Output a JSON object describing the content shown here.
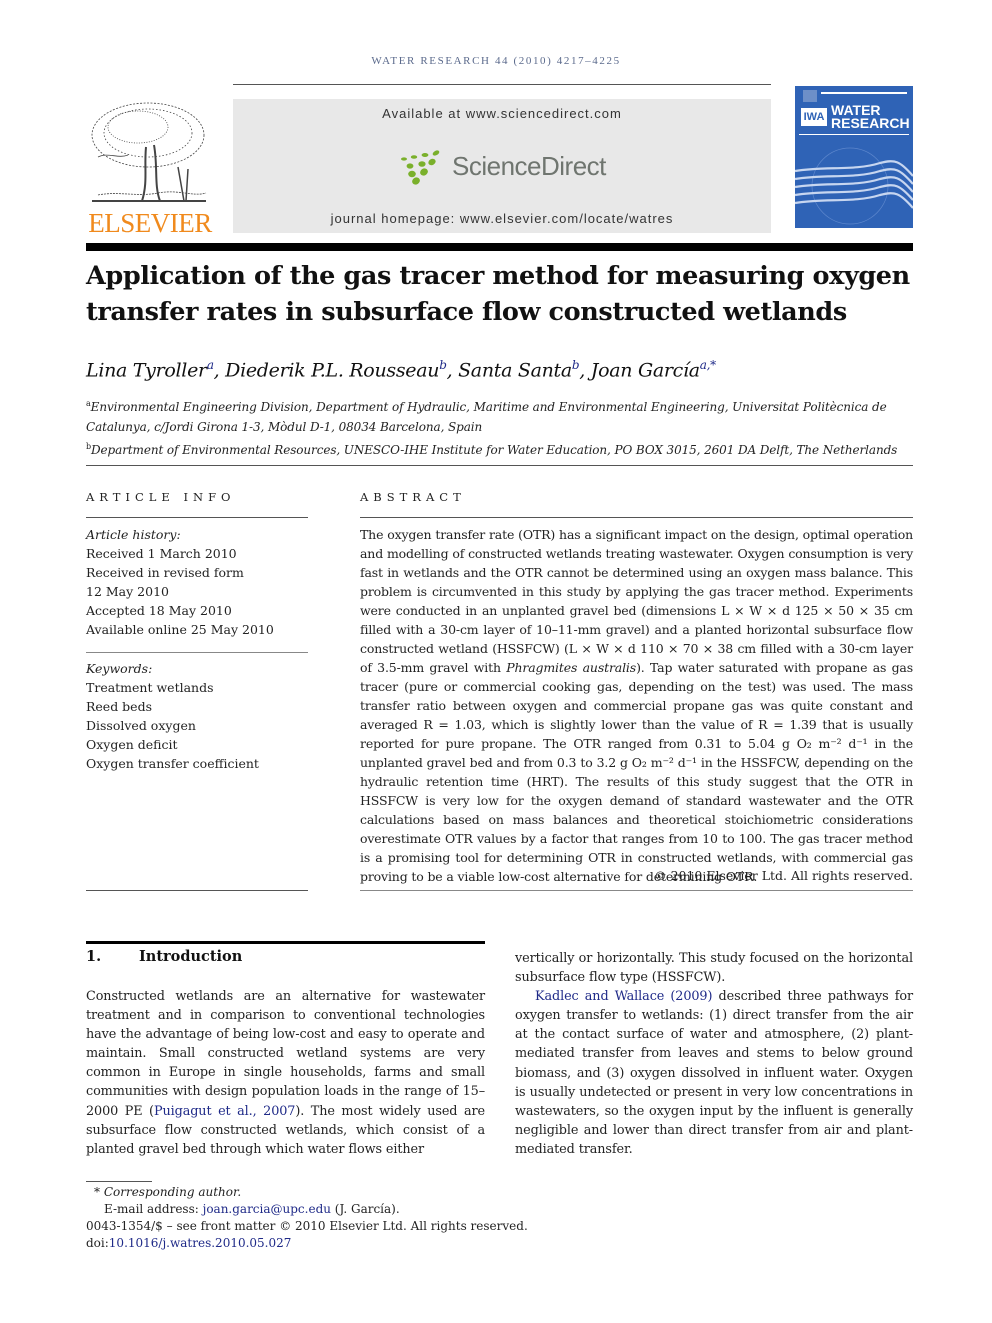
{
  "journal": {
    "running_head": "WATER RESEARCH 44 (2010) 4217–4225",
    "publisher_logo_text": "ELSEVIER",
    "sciencedirect": {
      "available_text": "Available at www.sciencedirect.com",
      "logo_text": "ScienceDirect",
      "homepage_text": "journal homepage: www.elsevier.com/locate/watres"
    },
    "cover": {
      "badge": "IWA",
      "title_line1": "WATER",
      "title_line2": "RESEARCH"
    },
    "colors": {
      "elsevier_orange": "#f08a1d",
      "sciencedirect_green": "#7ab02b",
      "cover_blue": "#2f63b6",
      "link_blue": "#1f2a88"
    }
  },
  "article": {
    "title": "Application of the gas tracer method for measuring oxygen transfer rates in subsurface flow constructed wetlands",
    "authors": [
      {
        "name": "Lina Tyroller",
        "sup": "a"
      },
      {
        "name": "Diederik P.L. Rousseau",
        "sup": "b"
      },
      {
        "name": "Santa Santa",
        "sup": "b"
      },
      {
        "name": "Joan García",
        "sup": "a,*"
      }
    ],
    "affiliations": [
      {
        "sup": "a",
        "text": "Environmental Engineering Division, Department of Hydraulic, Maritime and Environmental Engineering, Universitat Politècnica de Catalunya, c/Jordi Girona 1-3, Mòdul D-1, 08034 Barcelona, Spain"
      },
      {
        "sup": "b",
        "text": "Department of Environmental Resources, UNESCO-IHE Institute for Water Education, PO BOX 3015, 2601 DA Delft, The Netherlands"
      }
    ]
  },
  "article_info": {
    "heading": "ARTICLE INFO",
    "history_label": "Article history:",
    "history": [
      "Received 1 March 2010",
      "Received in revised form",
      "12 May 2010",
      "Accepted 18 May 2010",
      "Available online 25 May 2010"
    ],
    "keywords_label": "Keywords:",
    "keywords": [
      "Treatment wetlands",
      "Reed beds",
      "Dissolved oxygen",
      "Oxygen deficit",
      "Oxygen transfer coefficient"
    ]
  },
  "abstract": {
    "heading": "ABSTRACT",
    "part1": "The oxygen transfer rate (OTR) has a significant impact on the design, optimal operation and modelling of constructed wetlands treating wastewater. Oxygen consumption is very fast in wetlands and the OTR cannot be determined using an oxygen mass balance. This problem is circumvented in this study by applying the gas tracer method. Experiments were conducted in an unplanted gravel bed (dimensions L × W × d 125 × 50 × 35 cm filled with a 30-cm layer of 10–11-mm gravel) and a planted horizontal subsurface flow constructed wetland (HSSFCW) (L × W × d 110 × 70 × 38 cm filled with a 30-cm layer of 3.5-mm gravel with ",
    "species": "Phragmites australis",
    "part2": "). Tap water saturated with propane as gas tracer (pure or commercial cooking gas, depending on the test) was used. The mass transfer ratio between oxygen and commercial propane gas was quite constant and averaged R = 1.03, which is slightly lower than the value of R = 1.39 that is usually reported for pure propane. The OTR ranged from 0.31 to 5.04 g O₂ m⁻² d⁻¹ in the unplanted gravel bed and from 0.3 to 3.2 g O₂ m⁻² d⁻¹ in the HSSFCW, depending on the hydraulic retention time (HRT). The results of this study suggest that the OTR in HSSFCW is very low for the oxygen demand of standard wastewater and the OTR calculations based on mass balances and theoretical stoichiometric considerations overestimate OTR values by a factor that ranges from 10 to 100. The gas tracer method is a promising tool for determining OTR in constructed wetlands, with commercial gas proving to be a viable low-cost alternative for determining OTR.",
    "copyright": "© 2010 Elsevier Ltd. All rights reserved."
  },
  "introduction": {
    "number": "1.",
    "heading": "Introduction",
    "p1_before": "Constructed wetlands are an alternative for wastewater treatment and in comparison to conventional technologies have the advantage of being low-cost and easy to operate and maintain. Small constructed wetland systems are very common in Europe in single households, farms and small communities with design population loads in the range of 15–2000 PE (",
    "p1_cite": "Puigagut et al., 2007",
    "p1_after": "). The most widely used are subsurface flow constructed wetlands, which consist of a planted gravel bed through which water flows either vertically or horizontally. This study focused on the horizontal subsurface flow type (HSSFCW).",
    "p1_left_part": "Constructed wetlands are an alternative for wastewater treatment and in comparison to conventional technologies have the advantage of being low-cost and easy to operate and maintain. Small constructed wetland systems are very common in Europe in single households, farms and small communities with design population loads in the range of 15–2000 PE (",
    "p1_left_after": "). The most widely used are subsurface flow constructed wetlands, which consist of a planted gravel bed through which water flows either",
    "p1_right_part": "vertically or horizontally. This study focused on the horizontal subsurface flow type (HSSFCW).",
    "p2_cite": "Kadlec and Wallace (2009)",
    "p2_text": " described three pathways for oxygen transfer to wetlands: (1) direct transfer from the air at the contact surface of water and atmosphere, (2) plant-mediated transfer from leaves and stems to below ground biomass, and (3) oxygen dissolved in influent water. Oxygen is usually undetected or present in very low concentrations in wastewaters, so the oxygen input by the influent is generally negligible and lower than direct transfer from air and plant-mediated transfer."
  },
  "footnotes": {
    "star": "*",
    "corresponding": "Corresponding author.",
    "email_label": "E-mail address: ",
    "email": "joan.garcia@upc.edu",
    "email_after": " (J. García).",
    "issn_line": "0043-1354/$ – see front matter © 2010 Elsevier Ltd. All rights reserved.",
    "doi_label": "doi:",
    "doi": "10.1016/j.watres.2010.05.027"
  }
}
